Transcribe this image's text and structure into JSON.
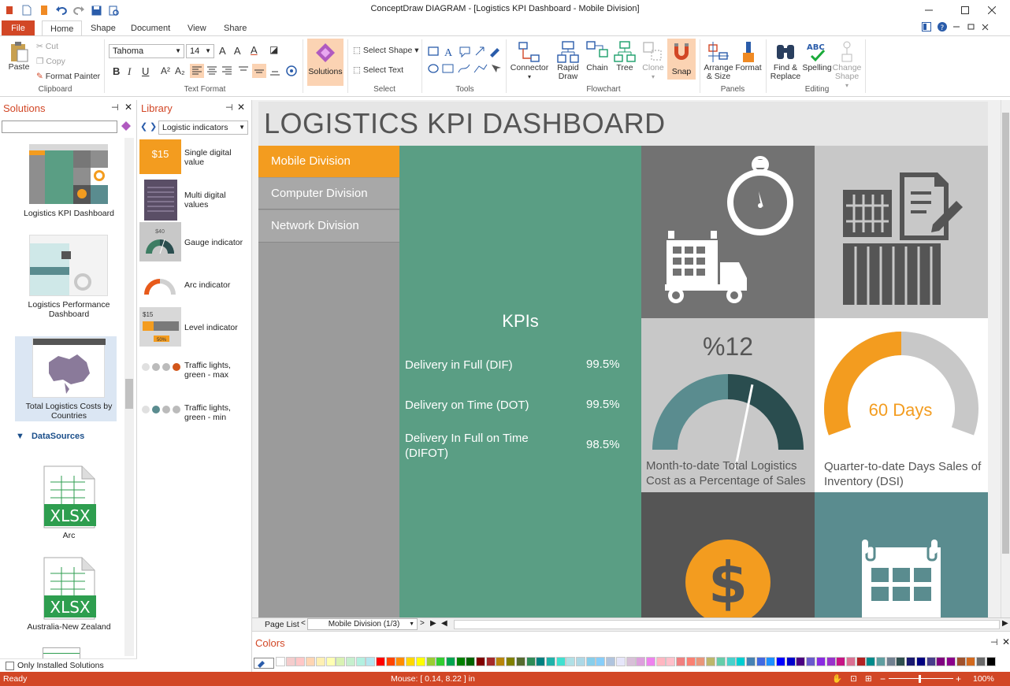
{
  "window": {
    "title": "ConceptDraw DIAGRAM - [Logistics KPI Dashboard - Mobile Division]"
  },
  "tabs": [
    "File",
    "Home",
    "Shape",
    "Document",
    "View",
    "Share"
  ],
  "ribbon": {
    "clipboard": {
      "paste": "Paste",
      "cut": "Cut",
      "copy": "Copy",
      "format_painter": "Format Painter",
      "group": "Clipboard"
    },
    "text_format": {
      "font": "Tahoma",
      "size": "14",
      "group": "Text Format"
    },
    "solutions": {
      "label": "Solutions"
    },
    "select": {
      "select_shape": "Select Shape",
      "select_text": "Select Text",
      "group": "Select"
    },
    "tools": {
      "group": "Tools"
    },
    "flowchart": {
      "connector": "Connector",
      "rapid_draw": "Rapid Draw",
      "chain": "Chain",
      "tree": "Tree",
      "clone": "Clone",
      "snap": "Snap",
      "group": "Flowchart"
    },
    "panels": {
      "arrange": "Arrange & Size",
      "format": "Format",
      "group": "Panels"
    },
    "editing": {
      "find": "Find & Replace",
      "spelling": "Spelling",
      "change_shape": "Change Shape",
      "group": "Editing"
    }
  },
  "solutions_panel": {
    "title": "Solutions",
    "items": [
      {
        "label": "Logistics KPI Dashboard"
      },
      {
        "label": "Logistics Performance Dashboard"
      },
      {
        "label": "Total Logistics Costs by Countries"
      }
    ],
    "datasources_title": "DataSources",
    "datasources": [
      {
        "label": "Arc",
        "file": "XLSX"
      },
      {
        "label": "Australia-New Zealand",
        "file": "XLSX"
      }
    ],
    "only_installed": "Only Installed Solutions"
  },
  "library_panel": {
    "title": "Library",
    "selected": "Logistic indicators",
    "items": [
      {
        "label": "Single digital value"
      },
      {
        "label": "Multi digital values"
      },
      {
        "label": "Gauge indicator"
      },
      {
        "label": "Arc indicator"
      },
      {
        "label": "Level indicator"
      },
      {
        "label": "Traffic lights, green - max"
      },
      {
        "label": "Traffic lights, green - min"
      }
    ],
    "thumb_texts": {
      "single": "$15",
      "gauge": "$40",
      "level": "$15",
      "level_pct": "50%"
    }
  },
  "dashboard": {
    "title": "LOGISTICS KPI DASHBOARD",
    "divisions": [
      "Mobile Division",
      "Computer Division",
      "Network Division"
    ],
    "kpis_title": "KPIs",
    "kpis": [
      {
        "name": "Delivery in Full (DIF)",
        "value": "99.5%"
      },
      {
        "name": "Delivery on Time (DOT)",
        "value": "99.5%"
      },
      {
        "name": "Delivery In Full on Time (DIFOT)",
        "value": "98.5%"
      }
    ],
    "gauge": {
      "value_text": "%12",
      "value": 12,
      "label": "Month-to-date Total Logistics Cost as a Percentage of Sales"
    },
    "arc": {
      "value_text": "60 Days",
      "fraction": 0.5,
      "label": "Quarter-to-date Days Sales of Inventory (DSI)"
    },
    "colors": {
      "orange": "#f39c1f",
      "teal": "#5a9e84",
      "gray": "#9b9b9b",
      "darkgray": "#555555",
      "slate": "#5a8c8f"
    }
  },
  "page_bar": {
    "page_list": "Page List",
    "page": "Mobile Division (1/3)"
  },
  "colors_panel": {
    "title": "Colors"
  },
  "statusbar": {
    "ready": "Ready",
    "mouse": "Mouse: [ 0.14, 8.22 ] in",
    "zoom": "100%"
  },
  "palette": [
    "#ffffff",
    "#f4cccc",
    "#ffc7c7",
    "#ffd5b3",
    "#fff0b3",
    "#ffffb3",
    "#d9f2b3",
    "#c6efce",
    "#b3f0e0",
    "#b3e6f0",
    "#ff0000",
    "#ff4500",
    "#ff8c00",
    "#ffd700",
    "#ffff00",
    "#9acd32",
    "#32cd32",
    "#00a550",
    "#008000",
    "#006400",
    "#800000",
    "#a52a2a",
    "#b8860b",
    "#808000",
    "#556b2f",
    "#2e8b57",
    "#008080",
    "#20b2aa",
    "#40e0d0",
    "#b0e0e6",
    "#add8e6",
    "#87ceeb",
    "#87cefa",
    "#b0c4de",
    "#e6e6fa",
    "#d8bfd8",
    "#dda0dd",
    "#ee82ee",
    "#ffb6c1",
    "#ffc0cb",
    "#f08080",
    "#fa8072",
    "#e9967a",
    "#bdb76b",
    "#66cdaa",
    "#48d1cc",
    "#00ced1",
    "#4682b4",
    "#4169e1",
    "#1e90ff",
    "#0000ff",
    "#0000cd",
    "#4b0082",
    "#6a5acd",
    "#8a2be2",
    "#9932cc",
    "#c71585",
    "#db7093",
    "#b22222",
    "#008b8b",
    "#5f9ea0",
    "#708090",
    "#2f4f4f",
    "#191970",
    "#000080",
    "#483d8b",
    "#800080",
    "#8b008b",
    "#a0522d",
    "#d2691e",
    "#696969",
    "#000000"
  ]
}
